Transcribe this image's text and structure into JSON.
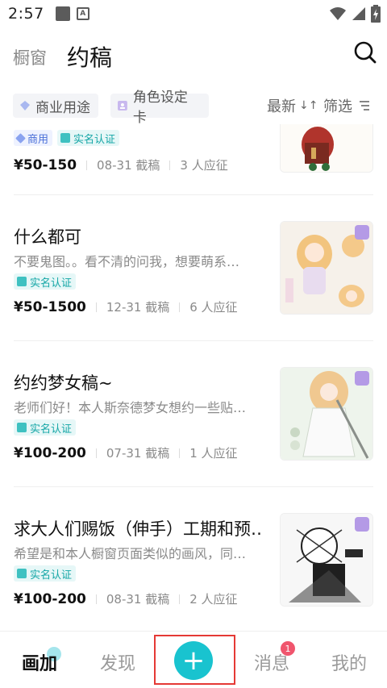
{
  "status_bar": {
    "time": "2:57",
    "notif_a": "A"
  },
  "header": {
    "tab_window": "橱窗",
    "tab_commission": "约稿"
  },
  "filters": {
    "chip_commercial": "商业用途",
    "chip_character": "角色设定卡",
    "sort_label": "最新",
    "sort_icon": "↓↑",
    "filter_label": "筛选"
  },
  "badge_labels": {
    "commercial": "商用",
    "verified": "实名认证"
  },
  "items": [
    {
      "title": "",
      "desc": "",
      "price": "¥50-150",
      "deadline": "08-31 截稿",
      "applicants": "3 人应征"
    },
    {
      "title": "什么都可",
      "desc": "不要鬼图。。看不清的问我，想要萌系…",
      "price": "¥50-1500",
      "deadline": "12-31 截稿",
      "applicants": "6 人应征"
    },
    {
      "title": "约约梦女稿~",
      "desc": "老师们好！本人斯奈德梦女想约一些贴…",
      "price": "¥100-200",
      "deadline": "07-31 截稿",
      "applicants": "1 人应征"
    },
    {
      "title": "求大人们赐饭（伸手）工期和预…",
      "desc": "希望是和本人橱窗页面类似的画风，同…",
      "price": "¥100-200",
      "deadline": "08-31 截稿",
      "applicants": "2 人应征"
    }
  ],
  "bottom_nav": {
    "huajia": "画加",
    "discover": "发现",
    "add": "+",
    "messages": "消息",
    "messages_badge": "1",
    "me": "我的"
  },
  "colors": {
    "accent": "#19c3cf",
    "badge_red": "#f0556d",
    "highlight_frame": "#e53935"
  }
}
